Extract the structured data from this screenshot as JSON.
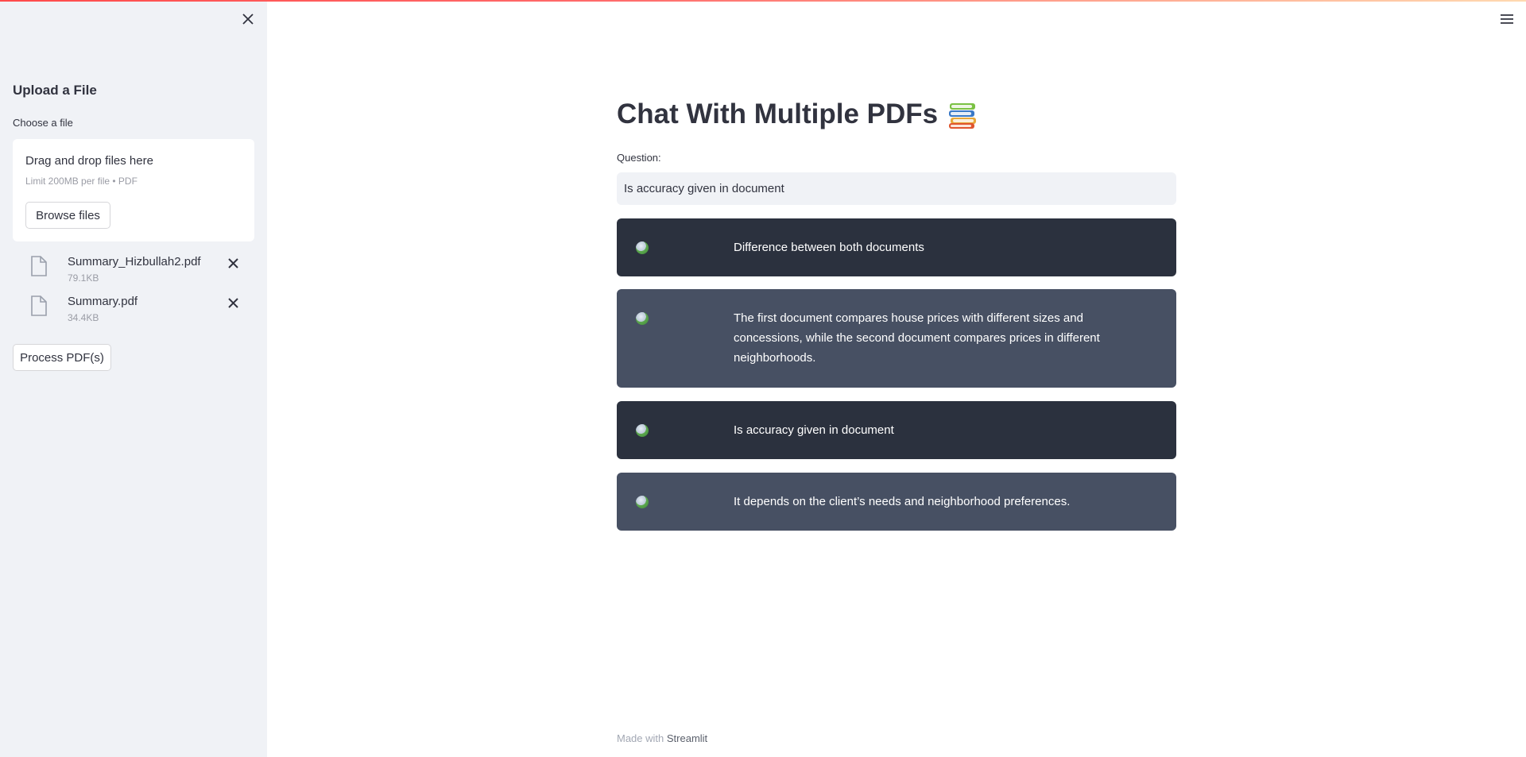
{
  "sidebar": {
    "header": "Upload a File",
    "uploader_label": "Choose a file",
    "dropzone_title": "Drag and drop files here",
    "dropzone_limit": "Limit 200MB per file • PDF",
    "browse_label": "Browse files",
    "files": [
      {
        "name": "Summary_Hizbullah2.pdf",
        "size": "79.1KB"
      },
      {
        "name": "Summary.pdf",
        "size": "34.4KB"
      }
    ],
    "process_label": "Process PDF(s)"
  },
  "main": {
    "title": "Chat With Multiple PDFs",
    "question_label": "Question:",
    "question_value": "Is accuracy given in document",
    "messages": [
      {
        "role": "user",
        "text": "Difference between both documents"
      },
      {
        "role": "bot",
        "text": "The first document compares house prices with different sizes and concessions, while the second document compares prices in different neighborhoods."
      },
      {
        "role": "user",
        "text": "Is accuracy given in document"
      },
      {
        "role": "bot",
        "text": "It depends on the client’s needs and neighborhood preferences."
      }
    ]
  },
  "footer": {
    "prefix": "Made with",
    "brand": "Streamlit"
  },
  "colors": {
    "sidebar_bg": "#f0f2f6",
    "user_msg_bg": "#2b313e",
    "bot_msg_bg": "#475063",
    "accent": "#ff4b4b"
  },
  "icons": {
    "close": "close-icon",
    "menu": "hamburger-menu-icon",
    "file": "file-icon",
    "title": "books-icon",
    "avatar": "avatar-icon"
  }
}
